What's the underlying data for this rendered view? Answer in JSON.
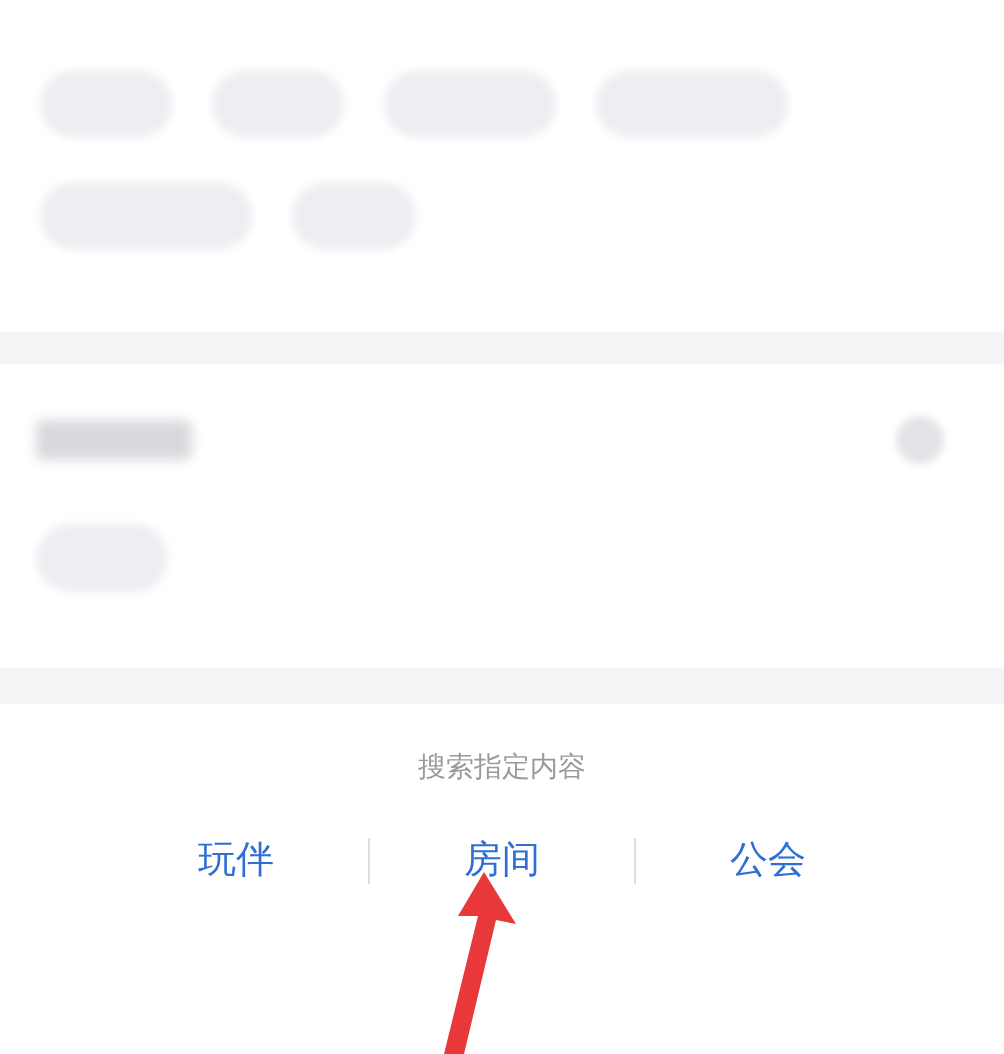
{
  "sections": [
    {
      "kind": "chips",
      "chips": [
        {
          "kind": "blurred"
        },
        {
          "kind": "blurred"
        },
        {
          "kind": "blurred"
        },
        {
          "kind": "blurred"
        },
        {
          "kind": "blurred"
        },
        {
          "kind": "blurred"
        }
      ]
    },
    {
      "kind": "titled",
      "chips": [
        {
          "kind": "blurred"
        }
      ]
    }
  ],
  "search_scope": {
    "caption": "搜索指定内容",
    "tabs": [
      {
        "label": "玩伴"
      },
      {
        "label": "房间"
      },
      {
        "label": "公会"
      }
    ]
  }
}
